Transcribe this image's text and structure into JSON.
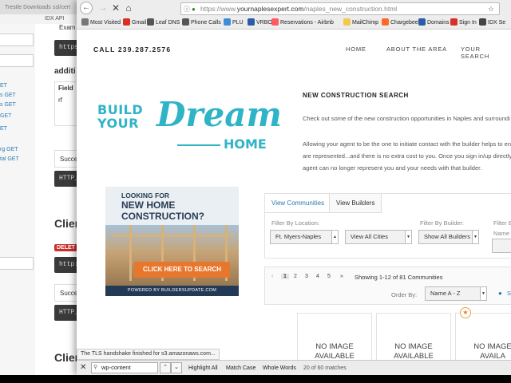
{
  "bg_window": {
    "tabs": [
      "Trestle Downloads",
      "ssl/cert",
      "Trest",
      "IDX API"
    ],
    "sidebar_links": [
      "ET",
      "s GET",
      "s GET",
      "GET",
      "ET",
      "rg GET",
      "tal GET"
    ],
    "main_texts": {
      "example": "Exam",
      "https_1": "https",
      "additional": "additi",
      "field": "Field",
      "rf": "rf",
      "success_1": "Succe",
      "http_1": "HTTP_",
      "client_1": "Clien",
      "delete": "DELET",
      "https_2": "http:",
      "success_2": "Succe",
      "http_2": "HTTP_",
      "client_2": "Clien"
    }
  },
  "browser": {
    "url_prefix": "https://www.",
    "url_domain": "yournaplesexpert.com",
    "url_path": "/naples_new_construction.html",
    "bookmarks": [
      {
        "label": "Most Visited",
        "icon": "gear-icon",
        "color": "#777777"
      },
      {
        "label": "Gmail",
        "icon": "gmail-icon",
        "color": "#d93025"
      },
      {
        "label": "Leaf DNS",
        "icon": "globe-icon",
        "color": "#555555"
      },
      {
        "label": "Phone Calls",
        "icon": "globe-icon",
        "color": "#555555"
      },
      {
        "label": "PLU",
        "icon": "pin-icon",
        "color": "#3b8ed6"
      },
      {
        "label": "VRBO",
        "icon": "v-icon",
        "color": "#2a5da8"
      },
      {
        "label": "Reservations - Airbnb",
        "icon": "airbnb-icon",
        "color": "#ff5a5f"
      },
      {
        "label": "MailChimp",
        "icon": "mailchimp-icon",
        "color": "#f2c94c"
      },
      {
        "label": "Chargebee",
        "icon": "chargebee-icon",
        "color": "#ff6a28"
      },
      {
        "label": "Domains",
        "icon": "domains-icon",
        "color": "#2a5da8"
      },
      {
        "label": "Sign In",
        "icon": "signin-icon",
        "color": "#d93025"
      },
      {
        "label": "IDX Se",
        "icon": "idx-icon",
        "color": "#444444"
      }
    ]
  },
  "page": {
    "phone": "CALL 239.287.2576",
    "nav": [
      "HOME",
      "ABOUT THE AREA",
      "YOUR SEARCH"
    ],
    "heading": "NEW CONSTRUCTION SEARCH",
    "intro_1": "Check out some of the new construction opportunities in Naples and surroundi",
    "intro_2": "Allowing your agent to be the one to initiate contact with the builder helps to en",
    "intro_3": "are represented...and there is no extra cost to you. Once you sign in/up directly",
    "intro_4": "agent can no longer represent you and your needs with that builder.",
    "logo": {
      "build": "BUILD",
      "your": "YOUR",
      "dream": "Dream",
      "home": "HOME"
    },
    "ad": {
      "line1": "LOOKING FOR",
      "line2a": "NEW HOME",
      "line2b": "CONSTRUCTION?",
      "cta": "CLICK HERE TO SEARCH",
      "footer": "POWERED BY BUILDERSUPDATE.COM"
    },
    "search": {
      "tabs": [
        "View Communities",
        "View Builders"
      ],
      "filter_location_label": "Filter By Location:",
      "filter_location_value": "Ft. Myers-Naples",
      "filter_cities_value": "View All Cities",
      "filter_builder_label": "Filter By Builder:",
      "filter_builder_value": "Show All Builders",
      "filter_extra_label": "Filter B",
      "filter_extra_value": "Name"
    },
    "pager": {
      "prev": "‹",
      "pages": [
        "1",
        "2",
        "3",
        "4",
        "5"
      ],
      "next": "»",
      "showing": "Showing 1-12 of 81 Communities",
      "order_label": "Order By:",
      "order_value": "Name A - Z",
      "pin_text": "S"
    },
    "cards": [
      {
        "line1": "NO IMAGE",
        "line2": "AVAILABLE"
      },
      {
        "line1": "NO IMAGE",
        "line2": "AVAILABLE"
      },
      {
        "line1": "NO IMAGE",
        "line2": "AVAILA"
      }
    ]
  },
  "status_tip": "The TLS handshake finished for s3.amazonaws.com...",
  "findbar": {
    "query": "wp-content",
    "highlight_all": "Highlight All",
    "match_case": "Match Case",
    "whole_words": "Whole Words",
    "count": "20 of 60 matches"
  }
}
